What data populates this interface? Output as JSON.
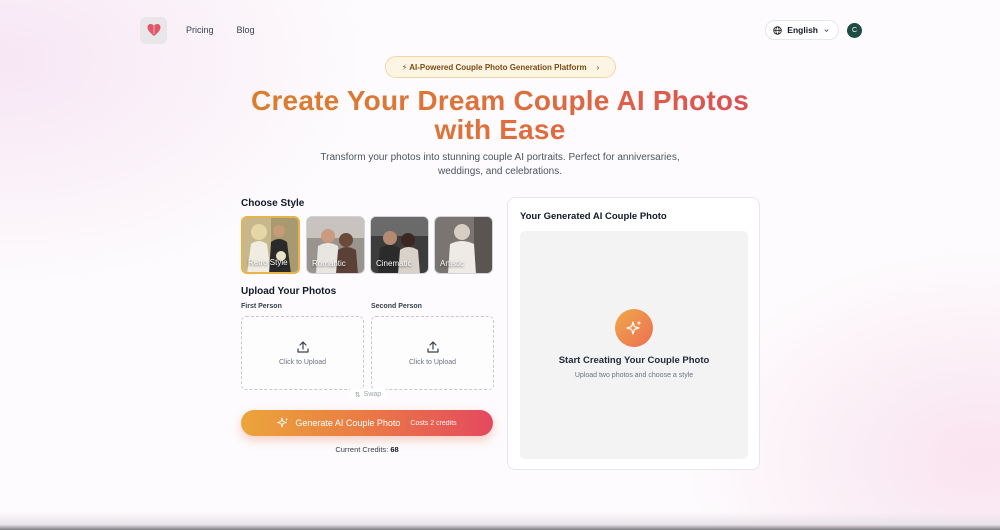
{
  "nav": {
    "links": [
      "Pricing",
      "Blog"
    ],
    "language": "English",
    "avatar_initial": "C"
  },
  "hero": {
    "badge": "⚡ AI-Powered Couple Photo Generation Platform",
    "title_line1": "Create Your Dream Couple AI Photos",
    "title_line2": "with Ease",
    "subtitle_line1": "Transform your photos into stunning couple AI portraits. Perfect for anniversaries,",
    "subtitle_line2": "weddings, and celebrations."
  },
  "styles": {
    "heading": "Choose Style",
    "selected": "Retro Style",
    "items": [
      {
        "label": "Retro Style",
        "color": "#b9a77a"
      },
      {
        "label": "Romantic",
        "color": "#8d8a86"
      },
      {
        "label": "Cinematic",
        "color": "#4a4a4a"
      },
      {
        "label": "Artistic",
        "color": "#6e6a66"
      }
    ]
  },
  "upload": {
    "heading": "Upload Your Photos",
    "first_label": "First Person",
    "second_label": "Second Person",
    "box_text": "Click to Upload",
    "swap": "Swap"
  },
  "generate": {
    "button": "Generate AI Couple Photo",
    "cost": "Costs 2 credits",
    "credits_label": "Current Credits:",
    "credits_value": "68"
  },
  "result": {
    "title": "Your Generated AI Couple Photo",
    "heading": "Start Creating Your Couple Photo",
    "sub": "Upload two photos and choose a style"
  },
  "colors": {
    "accent_orange": "#e97e3f",
    "accent_pink": "#e4495f",
    "badge_bg": "#fdf5e4",
    "avatar_bg": "#1e4d45"
  }
}
